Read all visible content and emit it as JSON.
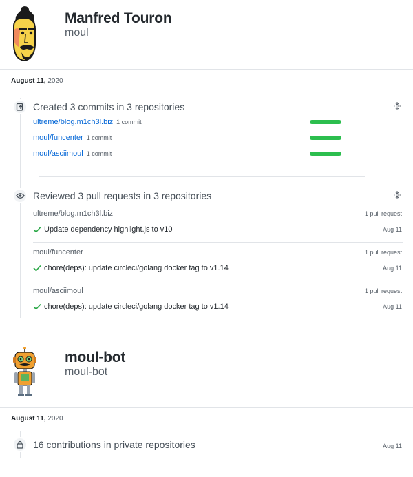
{
  "users": [
    {
      "name": "Manfred Touron",
      "login": "moul",
      "date_day": "August 11,",
      "date_year": "2020"
    },
    {
      "name": "moul-bot",
      "login": "moul-bot",
      "date_day": "August 11,",
      "date_year": "2020"
    }
  ],
  "commits": {
    "title": "Created 3 commits in 3 repositories",
    "icon": "repo-push-icon",
    "repos": [
      {
        "name": "ultreme/blog.m1ch3l.biz",
        "count": "1 commit"
      },
      {
        "name": "moul/funcenter",
        "count": "1 commit"
      },
      {
        "name": "moul/asciimoul",
        "count": "1 commit"
      }
    ],
    "bar_color": "#2cbe4e"
  },
  "reviews": {
    "title": "Reviewed 3 pull requests in 3 repositories",
    "icon": "eye-icon",
    "repos": [
      {
        "name": "ultreme/blog.m1ch3l.biz",
        "count": "1 pull request",
        "pr": "Update dependency highlight.js to v10",
        "date": "Aug 11"
      },
      {
        "name": "moul/funcenter",
        "count": "1 pull request",
        "pr": "chore(deps): update circleci/golang docker tag to v1.14",
        "date": "Aug 11"
      },
      {
        "name": "moul/asciimoul",
        "count": "1 pull request",
        "pr": "chore(deps): update circleci/golang docker tag to v1.14",
        "date": "Aug 11"
      }
    ]
  },
  "private": {
    "title": "16 contributions in private repositories",
    "date": "Aug 11",
    "icon": "lock-icon"
  }
}
